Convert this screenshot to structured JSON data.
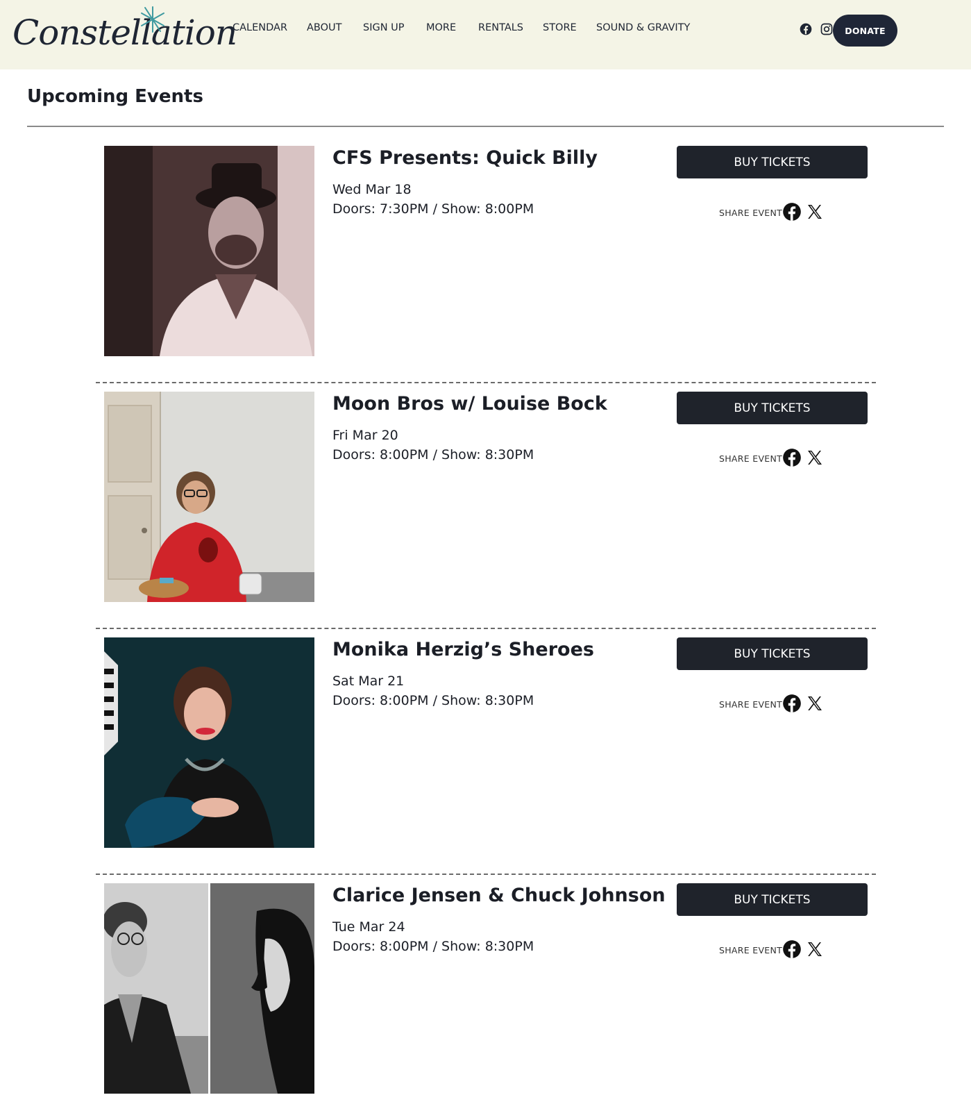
{
  "header": {
    "logo_text": "Constellation",
    "nav": [
      {
        "label": "CALENDAR"
      },
      {
        "label": "ABOUT"
      },
      {
        "label": "SIGN UP"
      },
      {
        "label": "MORE"
      },
      {
        "label": "RENTALS"
      },
      {
        "label": "STORE"
      },
      {
        "label": "SOUND & GRAVITY"
      }
    ],
    "social_icons": [
      "facebook-icon",
      "instagram-icon"
    ],
    "donate_label": "DONATE"
  },
  "page": {
    "title": "Upcoming Events"
  },
  "events": [
    {
      "title": "CFS Presents: Quick Billy",
      "date": "Wed Mar 18",
      "times": "Doors: 7:30PM / Show: 8:00PM",
      "buy_label": "BUY TICKETS",
      "share_label": "SHARE EVENT"
    },
    {
      "title": "Moon Bros w/ Louise Bock",
      "date": "Fri Mar 20",
      "times": "Doors: 8:00PM / Show: 8:30PM",
      "buy_label": "BUY TICKETS",
      "share_label": "SHARE EVENT"
    },
    {
      "title": "Monika Herzig’s Sheroes",
      "date": "Sat Mar 21",
      "times": "Doors: 8:00PM / Show: 8:30PM",
      "buy_label": "BUY TICKETS",
      "share_label": "SHARE EVENT"
    },
    {
      "title": "Clarice Jensen & Chuck Johnson",
      "date": "Tue Mar 24",
      "times": "Doors: 8:00PM / Show: 8:30PM",
      "buy_label": "BUY TICKETS",
      "share_label": "SHARE EVENT"
    }
  ],
  "colors": {
    "header_bg": "#f4f4e6",
    "button_dark": "#1f232b",
    "donate_bg": "#1f2637",
    "logo_star": "#3f9aa0"
  }
}
